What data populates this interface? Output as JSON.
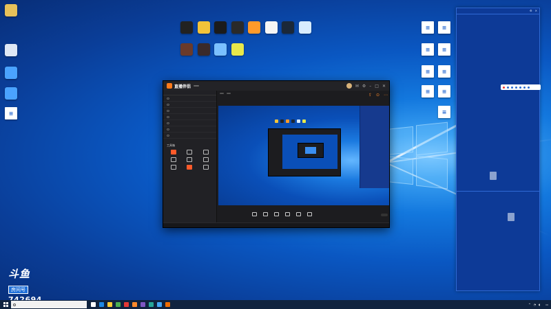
{
  "desktop": {
    "left_icons": [
      {
        "label": "",
        "icon": "folder-icon",
        "color": "#e7c15a"
      },
      {
        "label": "",
        "icon": "recycle-bin-icon",
        "color": "#dfe8f5"
      },
      {
        "label": "",
        "icon": "network-icon",
        "color": "#4aa3ff"
      },
      {
        "label": "",
        "icon": "pc-icon",
        "color": "#4aa3ff"
      },
      {
        "label": "",
        "icon": "document-icon",
        "color": "#ffffff"
      }
    ],
    "top_row1": [
      {
        "label": "",
        "icon": "app-icon",
        "color": "#222"
      },
      {
        "label": "",
        "icon": "app-icon",
        "color": "#f2c33a"
      },
      {
        "label": "",
        "icon": "app-icon",
        "color": "#1b1b1b"
      },
      {
        "label": "",
        "icon": "epic-games-icon",
        "color": "#2a2a2a"
      },
      {
        "label": "",
        "icon": "app-icon",
        "color": "#ff9a2a"
      },
      {
        "label": "",
        "icon": "app-icon",
        "color": "#f5f5f5"
      },
      {
        "label": "",
        "icon": "steam-icon",
        "color": "#1b2838"
      },
      {
        "label": "",
        "icon": "app-icon",
        "color": "#d8ecff"
      }
    ],
    "top_row2": [
      {
        "label": "",
        "icon": "game-icon",
        "color": "#6a3a2a"
      },
      {
        "label": "",
        "icon": "game-icon",
        "color": "#3a2a2a"
      },
      {
        "label": "",
        "icon": "app-icon",
        "color": "#7ac0ff"
      },
      {
        "label": "",
        "icon": "app-icon",
        "color": "#e8e84a"
      }
    ],
    "right_icons": [
      {
        "label": "",
        "icon": "document-icon"
      },
      {
        "label": "",
        "icon": "document-icon"
      },
      {
        "label": "",
        "icon": "document-icon"
      },
      {
        "label": "",
        "icon": "document-icon"
      },
      {
        "label": "",
        "icon": "document-icon"
      },
      {
        "label": "",
        "icon": "document-icon"
      },
      {
        "label": "",
        "icon": "document-icon"
      },
      {
        "label": "",
        "icon": "document-icon"
      },
      {
        "label": "",
        "icon": "document-icon"
      },
      {
        "label": "",
        "icon": "document-icon"
      },
      {
        "label": "",
        "icon": "document-icon"
      }
    ]
  },
  "watermark": {
    "brand": "斗鱼",
    "sub": "房间号",
    "room": "742694"
  },
  "app": {
    "name": "直播伴侣",
    "version": "",
    "tabs": [
      "",
      "",
      ""
    ],
    "scenes": [
      "",
      "",
      "",
      "",
      "",
      "",
      ""
    ],
    "tools_title": "工具箱",
    "tools": [
      {
        "label": ""
      },
      {
        "label": ""
      },
      {
        "label": ""
      },
      {
        "label": ""
      },
      {
        "label": ""
      },
      {
        "label": ""
      },
      {
        "label": ""
      },
      {
        "label": ""
      },
      {
        "label": ""
      }
    ],
    "bottom": [
      {
        "label": ""
      },
      {
        "label": ""
      },
      {
        "label": ""
      },
      {
        "label": ""
      },
      {
        "label": ""
      },
      {
        "label": ""
      }
    ],
    "start_live": "",
    "status": ""
  },
  "panel": {
    "title": "",
    "lines_top": [
      "",
      ""
    ],
    "lines_mid": [
      "",
      "",
      "",
      "",
      "",
      ""
    ],
    "lines_bottom": [
      "",
      ""
    ]
  },
  "taskbar": {
    "search_placeholder": "",
    "time": "",
    "date": "",
    "app_colors": [
      "#ffffff",
      "#1e88e5",
      "#ffcc33",
      "#4caf50",
      "#e53935",
      "#ff8a2a",
      "#7e57c2",
      "#26a69a",
      "#42a5f5",
      "#ef6c00"
    ]
  }
}
